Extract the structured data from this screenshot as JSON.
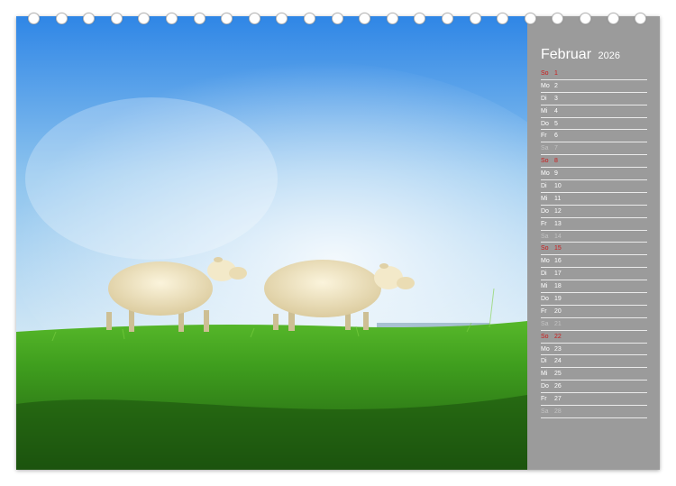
{
  "calendar": {
    "month": "Februar",
    "year": "2026",
    "days": [
      {
        "wd": "So",
        "d": "1",
        "type": "sun"
      },
      {
        "wd": "Mo",
        "d": "2",
        "type": "work"
      },
      {
        "wd": "Di",
        "d": "3",
        "type": "work"
      },
      {
        "wd": "Mi",
        "d": "4",
        "type": "work"
      },
      {
        "wd": "Do",
        "d": "5",
        "type": "work"
      },
      {
        "wd": "Fr",
        "d": "6",
        "type": "work"
      },
      {
        "wd": "Sa",
        "d": "7",
        "type": "sat"
      },
      {
        "wd": "So",
        "d": "8",
        "type": "sun"
      },
      {
        "wd": "Mo",
        "d": "9",
        "type": "work"
      },
      {
        "wd": "Di",
        "d": "10",
        "type": "work"
      },
      {
        "wd": "Mi",
        "d": "11",
        "type": "work"
      },
      {
        "wd": "Do",
        "d": "12",
        "type": "work"
      },
      {
        "wd": "Fr",
        "d": "13",
        "type": "work"
      },
      {
        "wd": "Sa",
        "d": "14",
        "type": "sat"
      },
      {
        "wd": "So",
        "d": "15",
        "type": "sun"
      },
      {
        "wd": "Mo",
        "d": "16",
        "type": "work"
      },
      {
        "wd": "Di",
        "d": "17",
        "type": "work"
      },
      {
        "wd": "Mi",
        "d": "18",
        "type": "work"
      },
      {
        "wd": "Do",
        "d": "19",
        "type": "work"
      },
      {
        "wd": "Fr",
        "d": "20",
        "type": "work"
      },
      {
        "wd": "Sa",
        "d": "21",
        "type": "sat"
      },
      {
        "wd": "So",
        "d": "22",
        "type": "sun"
      },
      {
        "wd": "Mo",
        "d": "23",
        "type": "work"
      },
      {
        "wd": "Di",
        "d": "24",
        "type": "work"
      },
      {
        "wd": "Mi",
        "d": "25",
        "type": "work"
      },
      {
        "wd": "Do",
        "d": "26",
        "type": "work"
      },
      {
        "wd": "Fr",
        "d": "27",
        "type": "work"
      },
      {
        "wd": "Sa",
        "d": "28",
        "type": "sat"
      }
    ]
  },
  "colors": {
    "panel": "#9b9b9b",
    "sunday": "#cc1a1a",
    "saturday": "#c3c3c3",
    "text": "#ffffff"
  },
  "photo": {
    "subject": "sheep-on-dike-photo"
  }
}
